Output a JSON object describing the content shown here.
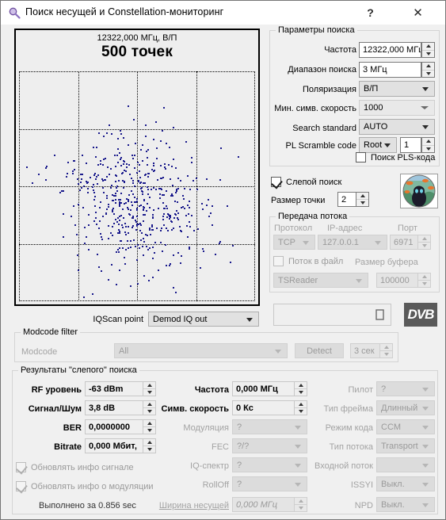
{
  "window": {
    "title": "Поиск несущей и Constellation-мониторинг",
    "icon": "magnifier-icon",
    "help_label": "?",
    "close_label": "✕"
  },
  "constellation": {
    "frequency_label": "12322,000 МГц, В/П",
    "points_label": "500 точек",
    "point_color": "#1a1a8c",
    "background": "#eeeeee",
    "grid": "dotted"
  },
  "iqscan": {
    "label": "IQScan point",
    "value": "Demod IQ out"
  },
  "modcode_filter": {
    "legend": "Modcode filter",
    "modcode_label": "Modcode",
    "modcode_value": "All",
    "detect_label": "Detect",
    "timeout_value": "3 сек"
  },
  "search_params": {
    "legend": "Параметры поиска",
    "rows": [
      {
        "label": "Частота",
        "value": "12322,000 МГц",
        "type": "spin"
      },
      {
        "label": "Диапазон поиска",
        "value": "3 МГц",
        "type": "spin"
      },
      {
        "label": "Поляризация",
        "value": "В/П",
        "type": "combo"
      },
      {
        "label": "Мин. симв. скорость",
        "value": "1000",
        "type": "combo-flat"
      },
      {
        "label": "Search standard",
        "value": "AUTO",
        "type": "combo"
      }
    ],
    "pl_scramble": {
      "label": "PL Scramble code",
      "mode": "Root",
      "code": "1"
    },
    "pls_search": {
      "label": "Поиск PLS-кода",
      "checked": false
    }
  },
  "blind_search": {
    "label": "Слепой поиск",
    "checked": true,
    "dot_size_label": "Размер точки",
    "dot_size_value": "2"
  },
  "stream_transfer": {
    "legend": "Передача потока",
    "protocol_label": "Протокол",
    "protocol_value": "TCP",
    "ip_label": "IP-адрес",
    "ip_value": "127.0.0.1",
    "port_label": "Порт",
    "port_value": "6971",
    "file_stream_label": "Поток в файл",
    "file_stream_checked": false,
    "file_stream_target": "TSReader",
    "buffer_label": "Размер буфера",
    "buffer_value": "100000"
  },
  "logo": {
    "dvb_label": "DVB",
    "search_box_value": ""
  },
  "results": {
    "legend": "Результаты \"слепого\" поиска",
    "col1": [
      {
        "label": "RF уровень",
        "value": "-63 dBm",
        "type": "spin-ro"
      },
      {
        "label": "Сигнал/Шум",
        "value": "3,8 dB",
        "type": "spin-ro"
      },
      {
        "label": "BER",
        "value": "0,0000000",
        "type": "spin-ro"
      },
      {
        "label": "Bitrate",
        "value": "0,000 Мбит,",
        "type": "spin-ro"
      }
    ],
    "col1_checks": [
      {
        "label": "Обновлять инфо сигнале",
        "checked": true
      },
      {
        "label": "Обновлять инфо о модуляции",
        "checked": true
      }
    ],
    "elapsed": "Выполнено за 0.856 sec",
    "col2": [
      {
        "label": "Частота",
        "value": "0,000 МГц",
        "type": "spin-ro"
      },
      {
        "label": "Симв. скорость",
        "value": "0 Кс",
        "type": "spin-ro"
      },
      {
        "label": "Модуляция",
        "value": "?",
        "type": "combo-dis"
      },
      {
        "label": "FEC",
        "value": "?/?",
        "type": "combo-dis"
      },
      {
        "label": "IQ-спектр",
        "value": "?",
        "type": "combo-dis"
      },
      {
        "label": "RollOff",
        "value": "?",
        "type": "combo-dis"
      },
      {
        "label": "Ширина несущей",
        "value": "0,000 МГц",
        "type": "spin-dis-it"
      }
    ],
    "col3": [
      {
        "label": "Пилот",
        "value": "?"
      },
      {
        "label": "Тип фрейма",
        "value": "Длинный"
      },
      {
        "label": "Режим кода",
        "value": "CCM"
      },
      {
        "label": "Тип потока",
        "value": "Transport"
      },
      {
        "label": "Входной поток",
        "value": ""
      },
      {
        "label": "ISSYI",
        "value": "Выкл."
      },
      {
        "label": "NPD",
        "value": "Выкл."
      }
    ]
  }
}
